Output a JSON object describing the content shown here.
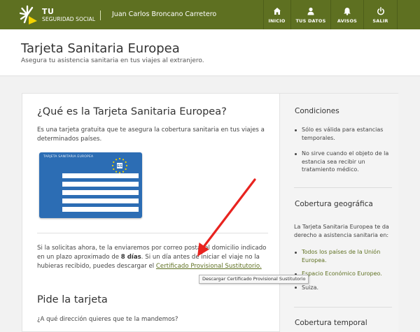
{
  "header": {
    "brand_line1": "TU",
    "brand_line2": "SEGURIDAD SOCIAL",
    "user_name": "Juan Carlos Broncano Carretero",
    "nav": [
      {
        "label": "INICIO",
        "icon": "home-icon"
      },
      {
        "label": "TUS DATOS",
        "icon": "user-icon"
      },
      {
        "label": "AVISOS",
        "icon": "bell-icon"
      },
      {
        "label": "SALIR",
        "icon": "power-icon"
      }
    ],
    "colors": {
      "bar": "#5e7021",
      "accent": "#f4d300"
    }
  },
  "page": {
    "title": "Tarjeta Sanitaria Europea",
    "subtitle": "Asegura tu asistencia sanitaria en tus viajes al extranjero."
  },
  "main": {
    "question_title": "¿Qué es la Tarjeta Sanitaria Europea?",
    "description": "Es una tarjeta gratuita que te asegura la cobertura sanitaria en tus viajes a determinados países.",
    "card_image": {
      "title": "TARJETA SANITARIA EUROPEA",
      "country_code": "ES",
      "color": "#2c6db4"
    },
    "delivery_text_1": "Si la solicitas ahora, te la enviaremos por correo postal al domicilio indicado en un plazo aproximado de ",
    "delivery_days": "8 días",
    "delivery_text_2": ". Si un día antes de iniciar el viaje no la hubieras recibido, puedes descargar el ",
    "certificate_link": "Certificado Provisional Sustitutorio.",
    "tooltip": "Descargar Certificado Provisional Sustitutorio",
    "request_title": "Pide la tarjeta",
    "address_question": "¿A qué dirección quieres que te la mandemos?"
  },
  "sidebar": {
    "conditions_title": "Condiciones",
    "conditions": [
      "Sólo es válida para estancias temporales.",
      "No sirve cuando el objeto de la estancia sea recibir un tratamiento médico."
    ],
    "coverage_title": "Cobertura geográfica",
    "coverage_intro": "La Tarjeta Sanitaria Europea te da derecho a asistencia sanitaria en:",
    "coverage_items": [
      "Todos los países de la Unión Europea.",
      "Espacio Económico Europeo.",
      "Suiza."
    ],
    "temporal_title": "Cobertura temporal"
  },
  "annotation": {
    "arrow_color": "#e8231f"
  }
}
